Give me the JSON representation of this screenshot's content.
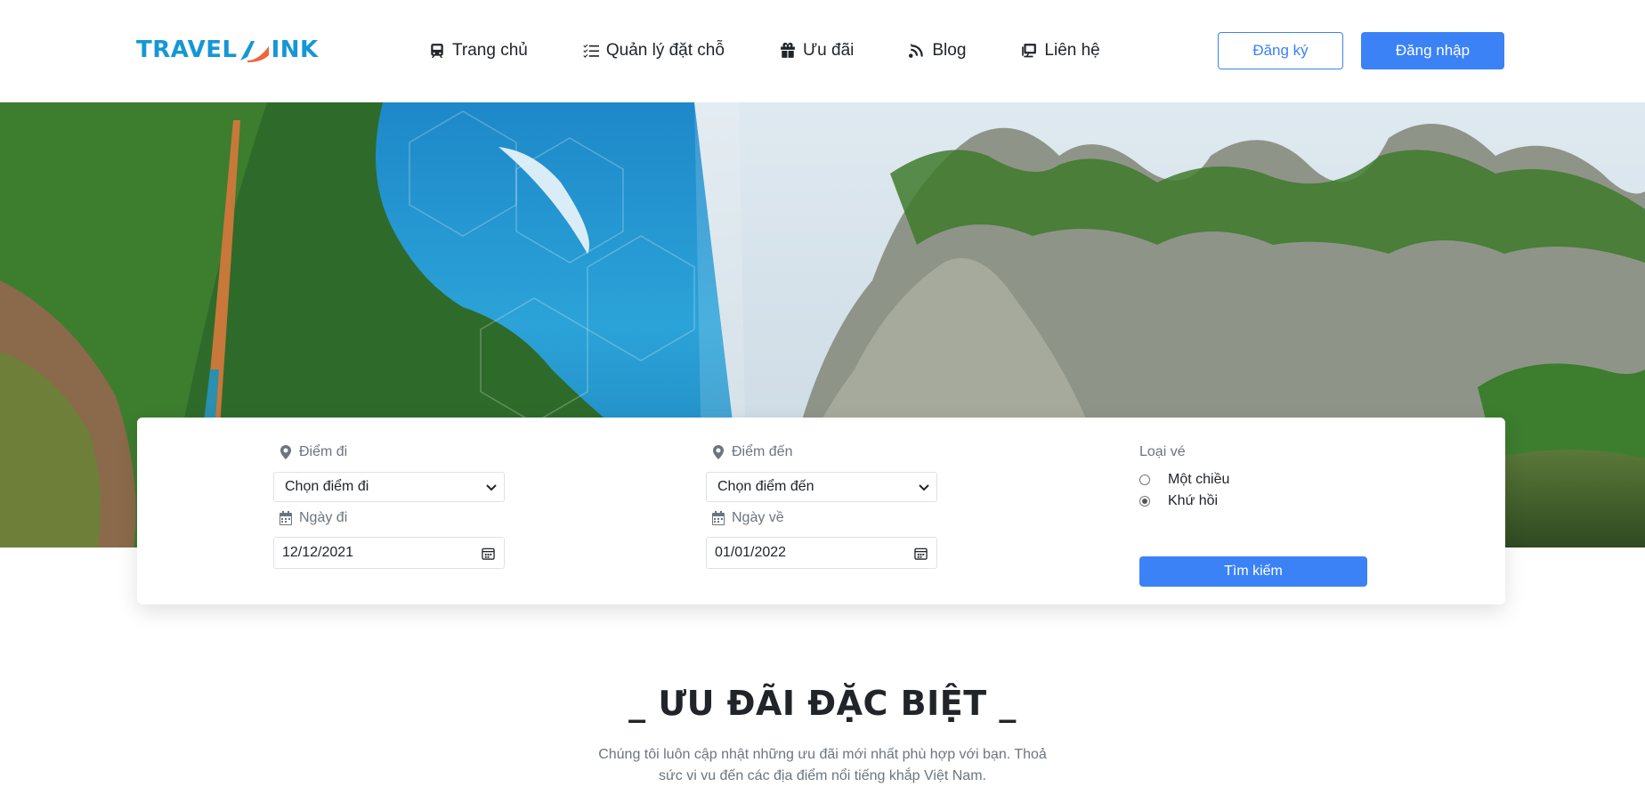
{
  "header": {
    "logo_left": "TRAVEL",
    "logo_right": "INK",
    "nav": [
      {
        "label": "Trang chủ",
        "icon": "train-icon"
      },
      {
        "label": "Quản lý đặt chỗ",
        "icon": "checklist-icon"
      },
      {
        "label": "Ưu đãi",
        "icon": "gift-icon"
      },
      {
        "label": "Blog",
        "icon": "blog-icon"
      },
      {
        "label": "Liên hệ",
        "icon": "contact-icon"
      }
    ],
    "register_label": "Đăng ký",
    "login_label": "Đăng nhập"
  },
  "search": {
    "from_label": "Điểm đi",
    "from_value": "Chọn điểm đi",
    "to_label": "Điểm đến",
    "to_value": "Chọn điểm đến",
    "depart_label": "Ngày đi",
    "depart_value": "12/12/2021",
    "return_label": "Ngày về",
    "return_value": "01/01/2022",
    "ticket_type_label": "Loại vé",
    "one_way_label": "Một chiều",
    "round_trip_label": "Khứ hồi",
    "selected_ticket_type": "round_trip",
    "search_label": "Tìm kiếm"
  },
  "offers": {
    "title": "_ ƯU ĐÃI ĐẶC BIỆT _",
    "description": "Chúng tôi luôn cập nhật những ưu đãi mới nhất phù hợp với bạn. Thoả sức vi vu đến các địa điểm nổi tiếng khắp Việt Nam."
  },
  "colors": {
    "primary": "#3b82f6",
    "logo": "#1597d5",
    "logo_accent": "#f0643c"
  }
}
